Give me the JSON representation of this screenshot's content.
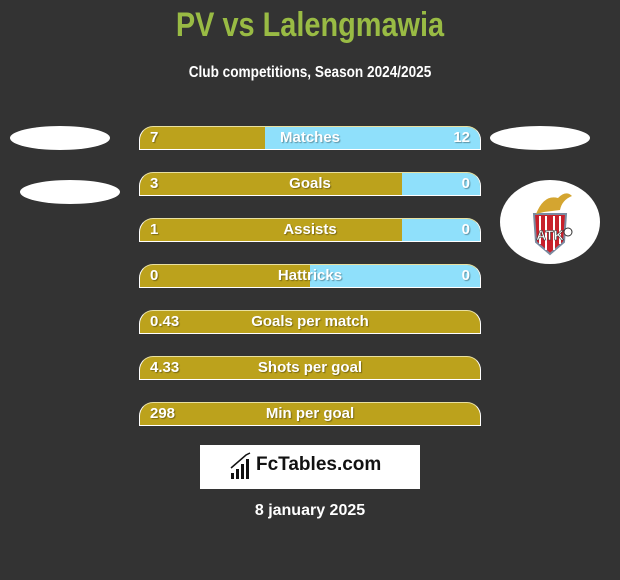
{
  "header": {
    "title": "PV vs Lalengmawia",
    "subtitle": "Club competitions, Season 2024/2025"
  },
  "colors": {
    "left": "#bca21c",
    "right": "#8fe0fb",
    "title": "#99bb44",
    "background": "#333333"
  },
  "stats": [
    {
      "label": "Matches",
      "left": "7",
      "right": "12",
      "left_share": 0.3684
    },
    {
      "label": "Goals",
      "left": "3",
      "right": "0",
      "left_share": 0.77
    },
    {
      "label": "Assists",
      "left": "1",
      "right": "0",
      "left_share": 0.77
    },
    {
      "label": "Hattricks",
      "left": "0",
      "right": "0",
      "left_share": 0.5
    },
    {
      "label": "Goals per match",
      "left": "0.43",
      "right": "",
      "left_share": 1
    },
    {
      "label": "Shots per goal",
      "left": "4.33",
      "right": "",
      "left_share": 1
    },
    {
      "label": "Min per goal",
      "left": "298",
      "right": "",
      "left_share": 1
    }
  ],
  "right_team_logo": {
    "icon": "atk-club-crest-icon",
    "text": "ATK"
  },
  "brand": {
    "name": "FcTables.com",
    "icon": "bar-chart-icon"
  },
  "date": "8 january 2025"
}
